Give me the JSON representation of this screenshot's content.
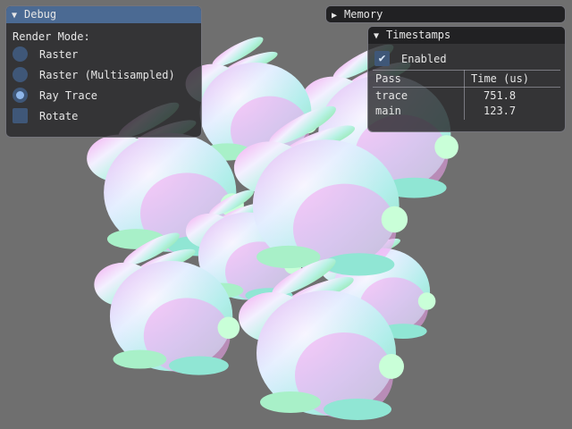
{
  "scene": {
    "background": "#6f6f6f",
    "object": "bunny"
  },
  "debug": {
    "title": "Debug",
    "render_mode_label": "Render Mode:",
    "options": [
      "Raster",
      "Raster (Multisampled)",
      "Ray Trace"
    ],
    "selected": "Ray Trace",
    "rotate_label": "Rotate",
    "rotate_checked": false
  },
  "memory": {
    "title": "Memory"
  },
  "timestamps": {
    "title": "Timestamps",
    "enabled_label": "Enabled",
    "enabled_checked": true,
    "columns": [
      "Pass",
      "Time (us)"
    ],
    "rows": [
      {
        "pass": "trace",
        "time": "751.8"
      },
      {
        "pass": "main",
        "time": "123.7"
      }
    ]
  },
  "icons": {
    "expanded": "triangle-down-icon",
    "collapsed": "triangle-right-icon",
    "checked": "checkmark-icon"
  }
}
